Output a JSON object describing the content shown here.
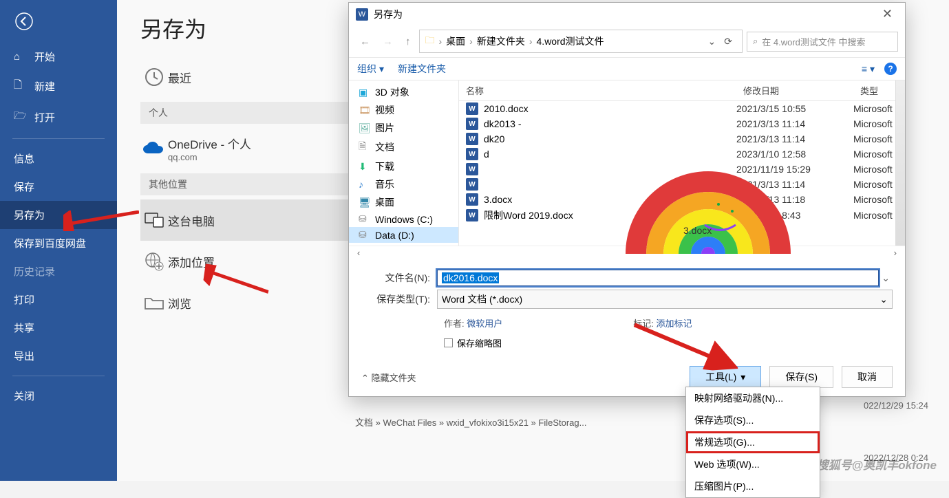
{
  "page_title": "另存为",
  "sidebar": {
    "home": "开始",
    "new": "新建",
    "open": "打开",
    "info": "信息",
    "save": "保存",
    "saveas": "另存为",
    "baidu": "保存到百度网盘",
    "history": "历史记录",
    "print": "打印",
    "share": "共享",
    "export": "导出",
    "close": "关闭"
  },
  "locations": {
    "recent": "最近",
    "personal_head": "个人",
    "onedrive_title": "OneDrive - 个人",
    "onedrive_sub": "qq.com",
    "other_head": "其他位置",
    "this_pc": "这台电脑",
    "add_place": "添加位置",
    "browse": "浏览"
  },
  "dialog": {
    "title": "另存为",
    "path_parts": [
      "桌面",
      "新建文件夹",
      "4.word测试文件"
    ],
    "search_placeholder": "在 4.word测试文件 中搜索",
    "organize": "组织",
    "new_folder": "新建文件夹",
    "tree": {
      "obj3d": "3D 对象",
      "video": "视频",
      "pictures": "图片",
      "documents": "文档",
      "downloads": "下载",
      "music": "音乐",
      "desktop": "桌面",
      "cdrive": "Windows (C:)",
      "ddrive": "Data (D:)"
    },
    "list_head": {
      "name": "名称",
      "date": "修改日期",
      "type": "类型"
    },
    "files": [
      {
        "name": "2010.docx",
        "date": "2021/3/15 10:55",
        "type": "Microsoft"
      },
      {
        "name": "dk2013 -",
        "date": "2021/3/13 11:14",
        "type": "Microsoft"
      },
      {
        "name": "dk20",
        "date": "2021/3/13 11:14",
        "type": "Microsoft"
      },
      {
        "name": "d",
        "date": "2023/1/10 12:58",
        "type": "Microsoft"
      },
      {
        "name": "",
        "date": "2021/11/19 15:29",
        "type": "Microsoft"
      },
      {
        "name": "",
        "date": "2021/3/13 11:14",
        "type": "Microsoft"
      },
      {
        "name": "3.docx",
        "date": "2021/3/13 11:18",
        "type": "Microsoft"
      },
      {
        "name": "限制Word 2019.docx",
        "date": "2021/3/15 8:43",
        "type": "Microsoft"
      }
    ],
    "filename_label": "文件名(N):",
    "filename_value": "dk2016.docx",
    "filetype_label": "保存类型(T):",
    "filetype_value": "Word 文档 (*.docx)",
    "author_label": "作者:",
    "author_value": "微软用户",
    "tags_label": "标记:",
    "tags_value": "添加标记",
    "thumb_check": "保存缩略图",
    "hide_folders": "隐藏文件夹",
    "tools_btn": "工具(L)",
    "save_btn": "保存(S)",
    "cancel_btn": "取消"
  },
  "tools_menu": {
    "map_drive": "映射网络驱动器(N)...",
    "save_opts": "保存选项(S)...",
    "general_opts": "常规选项(G)...",
    "web_opts": "Web 选项(W)...",
    "compress": "压缩图片(P)..."
  },
  "bg": {
    "crumb": "文档 » WeChat Files » wxid_vfokixo3i15x21 » FileStorag...",
    "date1": "022/12/29 15:24",
    "date2": "2022/12/28 0:24"
  },
  "watermark": "搜狐号@奥凯丰okfone"
}
